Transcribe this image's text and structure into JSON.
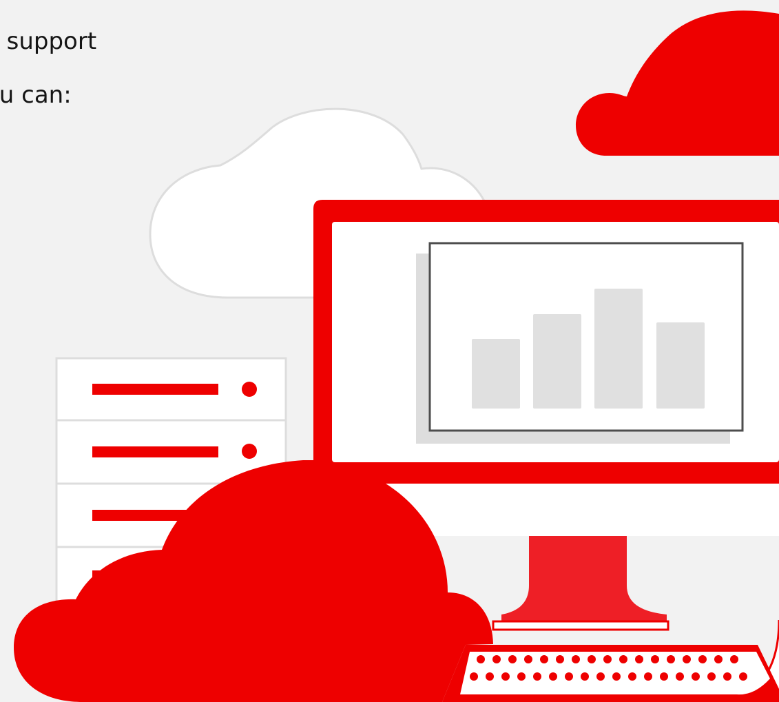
{
  "intro": {
    "line_1": "o support",
    "line_2": "ou can:"
  },
  "illustration": {
    "icons": [
      "cloud-outline-icon",
      "cloud-icon",
      "server-rack-icon",
      "monitor-icon",
      "bar-chart-icon",
      "keyboard-icon"
    ],
    "colors": {
      "brand_red": "#ee0000",
      "panel_background": "#f2f2f2",
      "border_grey": "#dddddd",
      "chart_bar_grey": "#e0e0e0",
      "frame_dark": "#4d4d4d"
    }
  }
}
